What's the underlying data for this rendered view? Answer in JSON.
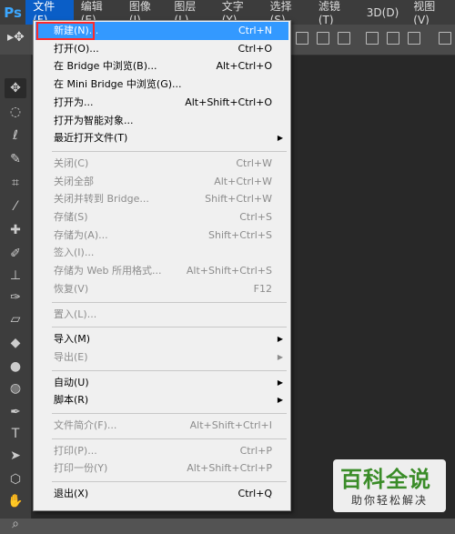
{
  "app": {
    "logo": "Ps"
  },
  "menubar": [
    {
      "label": "文件(F)",
      "active": true
    },
    {
      "label": "编辑(E)"
    },
    {
      "label": "图像(I)"
    },
    {
      "label": "图层(L)"
    },
    {
      "label": "文字(Y)"
    },
    {
      "label": "选择(S)"
    },
    {
      "label": "滤镜(T)"
    },
    {
      "label": "3D(D)"
    },
    {
      "label": "视图(V)"
    }
  ],
  "file_menu": [
    {
      "label": "新建(N)...",
      "shortcut": "Ctrl+N",
      "highlighted": true
    },
    {
      "label": "打开(O)...",
      "shortcut": "Ctrl+O"
    },
    {
      "label": "在 Bridge 中浏览(B)...",
      "shortcut": "Alt+Ctrl+O"
    },
    {
      "label": "在 Mini Bridge 中浏览(G)...",
      "shortcut": ""
    },
    {
      "label": "打开为...",
      "shortcut": "Alt+Shift+Ctrl+O"
    },
    {
      "label": "打开为智能对象...",
      "shortcut": ""
    },
    {
      "label": "最近打开文件(T)",
      "shortcut": "",
      "submenu": true
    },
    {
      "separator": true
    },
    {
      "label": "关闭(C)",
      "shortcut": "Ctrl+W",
      "disabled": true
    },
    {
      "label": "关闭全部",
      "shortcut": "Alt+Ctrl+W",
      "disabled": true
    },
    {
      "label": "关闭并转到 Bridge...",
      "shortcut": "Shift+Ctrl+W",
      "disabled": true
    },
    {
      "label": "存储(S)",
      "shortcut": "Ctrl+S",
      "disabled": true
    },
    {
      "label": "存储为(A)...",
      "shortcut": "Shift+Ctrl+S",
      "disabled": true
    },
    {
      "label": "签入(I)...",
      "shortcut": "",
      "disabled": true
    },
    {
      "label": "存储为 Web 所用格式...",
      "shortcut": "Alt+Shift+Ctrl+S",
      "disabled": true
    },
    {
      "label": "恢复(V)",
      "shortcut": "F12",
      "disabled": true
    },
    {
      "separator": true
    },
    {
      "label": "置入(L)...",
      "shortcut": "",
      "disabled": true
    },
    {
      "separator": true
    },
    {
      "label": "导入(M)",
      "shortcut": "",
      "submenu": true
    },
    {
      "label": "导出(E)",
      "shortcut": "",
      "submenu": true,
      "disabled": true
    },
    {
      "separator": true
    },
    {
      "label": "自动(U)",
      "shortcut": "",
      "submenu": true
    },
    {
      "label": "脚本(R)",
      "shortcut": "",
      "submenu": true
    },
    {
      "separator": true
    },
    {
      "label": "文件简介(F)...",
      "shortcut": "Alt+Shift+Ctrl+I",
      "disabled": true
    },
    {
      "separator": true
    },
    {
      "label": "打印(P)...",
      "shortcut": "Ctrl+P",
      "disabled": true
    },
    {
      "label": "打印一份(Y)",
      "shortcut": "Alt+Shift+Ctrl+P",
      "disabled": true
    },
    {
      "separator": true
    },
    {
      "label": "退出(X)",
      "shortcut": "Ctrl+Q"
    }
  ],
  "toolbox": [
    {
      "icon": "move-icon",
      "glyph": "✥",
      "selected": true
    },
    {
      "icon": "marquee-icon",
      "glyph": "◌"
    },
    {
      "icon": "lasso-icon",
      "glyph": "ℓ"
    },
    {
      "icon": "quick-select-icon",
      "glyph": "✎"
    },
    {
      "icon": "crop-icon",
      "glyph": "⌗"
    },
    {
      "icon": "eyedropper-icon",
      "glyph": "⁄"
    },
    {
      "icon": "healing-icon",
      "glyph": "✚"
    },
    {
      "icon": "brush-icon",
      "glyph": "✐"
    },
    {
      "icon": "stamp-icon",
      "glyph": "⊥"
    },
    {
      "icon": "history-brush-icon",
      "glyph": "✑"
    },
    {
      "icon": "eraser-icon",
      "glyph": "▱"
    },
    {
      "icon": "paint-bucket-icon",
      "glyph": "◆"
    },
    {
      "icon": "blur-icon",
      "glyph": "●"
    },
    {
      "icon": "dodge-icon",
      "glyph": "◍"
    },
    {
      "icon": "pen-icon",
      "glyph": "✒"
    },
    {
      "icon": "text-icon",
      "glyph": "T"
    },
    {
      "icon": "path-select-icon",
      "glyph": "➤"
    },
    {
      "icon": "shape-icon",
      "glyph": "⬡"
    },
    {
      "icon": "hand-icon",
      "glyph": "✋"
    },
    {
      "icon": "zoom-icon",
      "glyph": "⌕"
    }
  ],
  "watermark": {
    "line1": "百科全说",
    "line2": "助你轻松解决"
  }
}
